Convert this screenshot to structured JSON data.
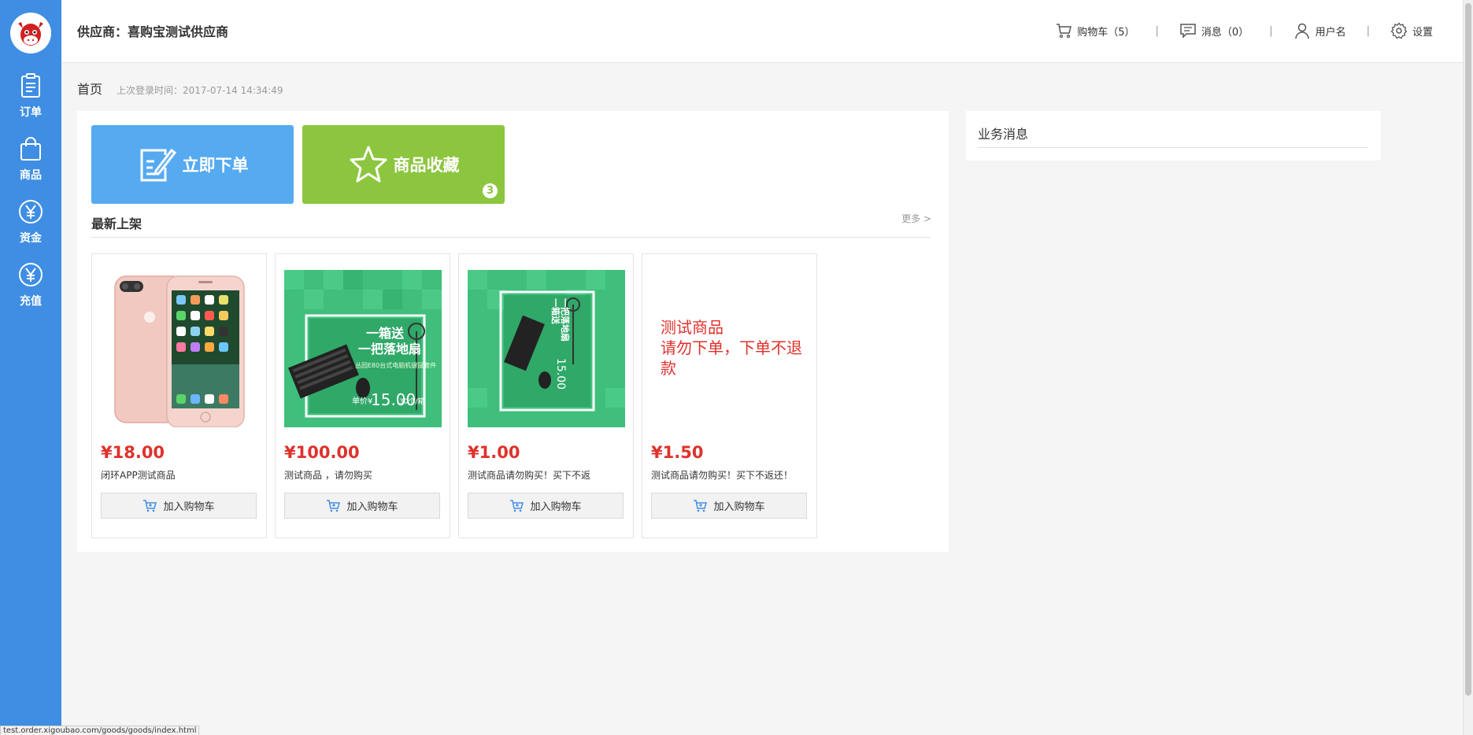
{
  "header": {
    "supplier": "供应商：喜购宝测试供应商",
    "cart_label": "购物车（5）",
    "messages_label": "消息（0）",
    "username": "用户名",
    "settings_label": "设置",
    "separator": "|"
  },
  "sidebar": {
    "items": [
      {
        "label": "订单",
        "icon": "clipboard-icon"
      },
      {
        "label": "商品",
        "icon": "bag-icon"
      },
      {
        "label": "资金",
        "icon": "yen-icon"
      },
      {
        "label": "充值",
        "icon": "yen-icon"
      }
    ]
  },
  "breadcrumb": {
    "home": "首页",
    "last_login": "上次登录时间：2017-07-14 14:34:49"
  },
  "quick_actions": {
    "order_label": "立即下单",
    "favorites_label": "商品收藏",
    "favorites_badge": "3"
  },
  "new_arrivals": {
    "title": "最新上架",
    "more": "更多 >",
    "add_to_cart_label": "加入购物车",
    "products": [
      {
        "price": "¥18.00",
        "name": "闭环APP测试商品",
        "image": "phone"
      },
      {
        "price": "¥100.00",
        "name": "测试商品 ，请勿购买",
        "image": "keyboard-promo"
      },
      {
        "price": "¥1.00",
        "name": "测试商品请勿购买！买下不返",
        "image": "keyboard-promo-rotated"
      },
      {
        "price": "¥1.50",
        "name": "测试商品请勿购买！买下不返还！",
        "image": "text-notice",
        "image_text_line1": "测试商品",
        "image_text_line2": "请勿下单，下单不退款"
      }
    ]
  },
  "business_messages": {
    "title": "业务消息"
  },
  "promo_image": {
    "line1": "一箱送",
    "line2": "一把落地扇",
    "line3": "丛园E80台式电脑机键鼠套件",
    "price_prefix": "单价¥",
    "price": "15.00",
    "qty": "30个/箱"
  },
  "status_url": "test.order.xigoubao.com/goods/goods/index.html",
  "colors": {
    "sidebar": "#3f8ee3",
    "tile_order": "#56aaf0",
    "tile_favorites": "#8cc63f",
    "price": "#e0312b"
  }
}
